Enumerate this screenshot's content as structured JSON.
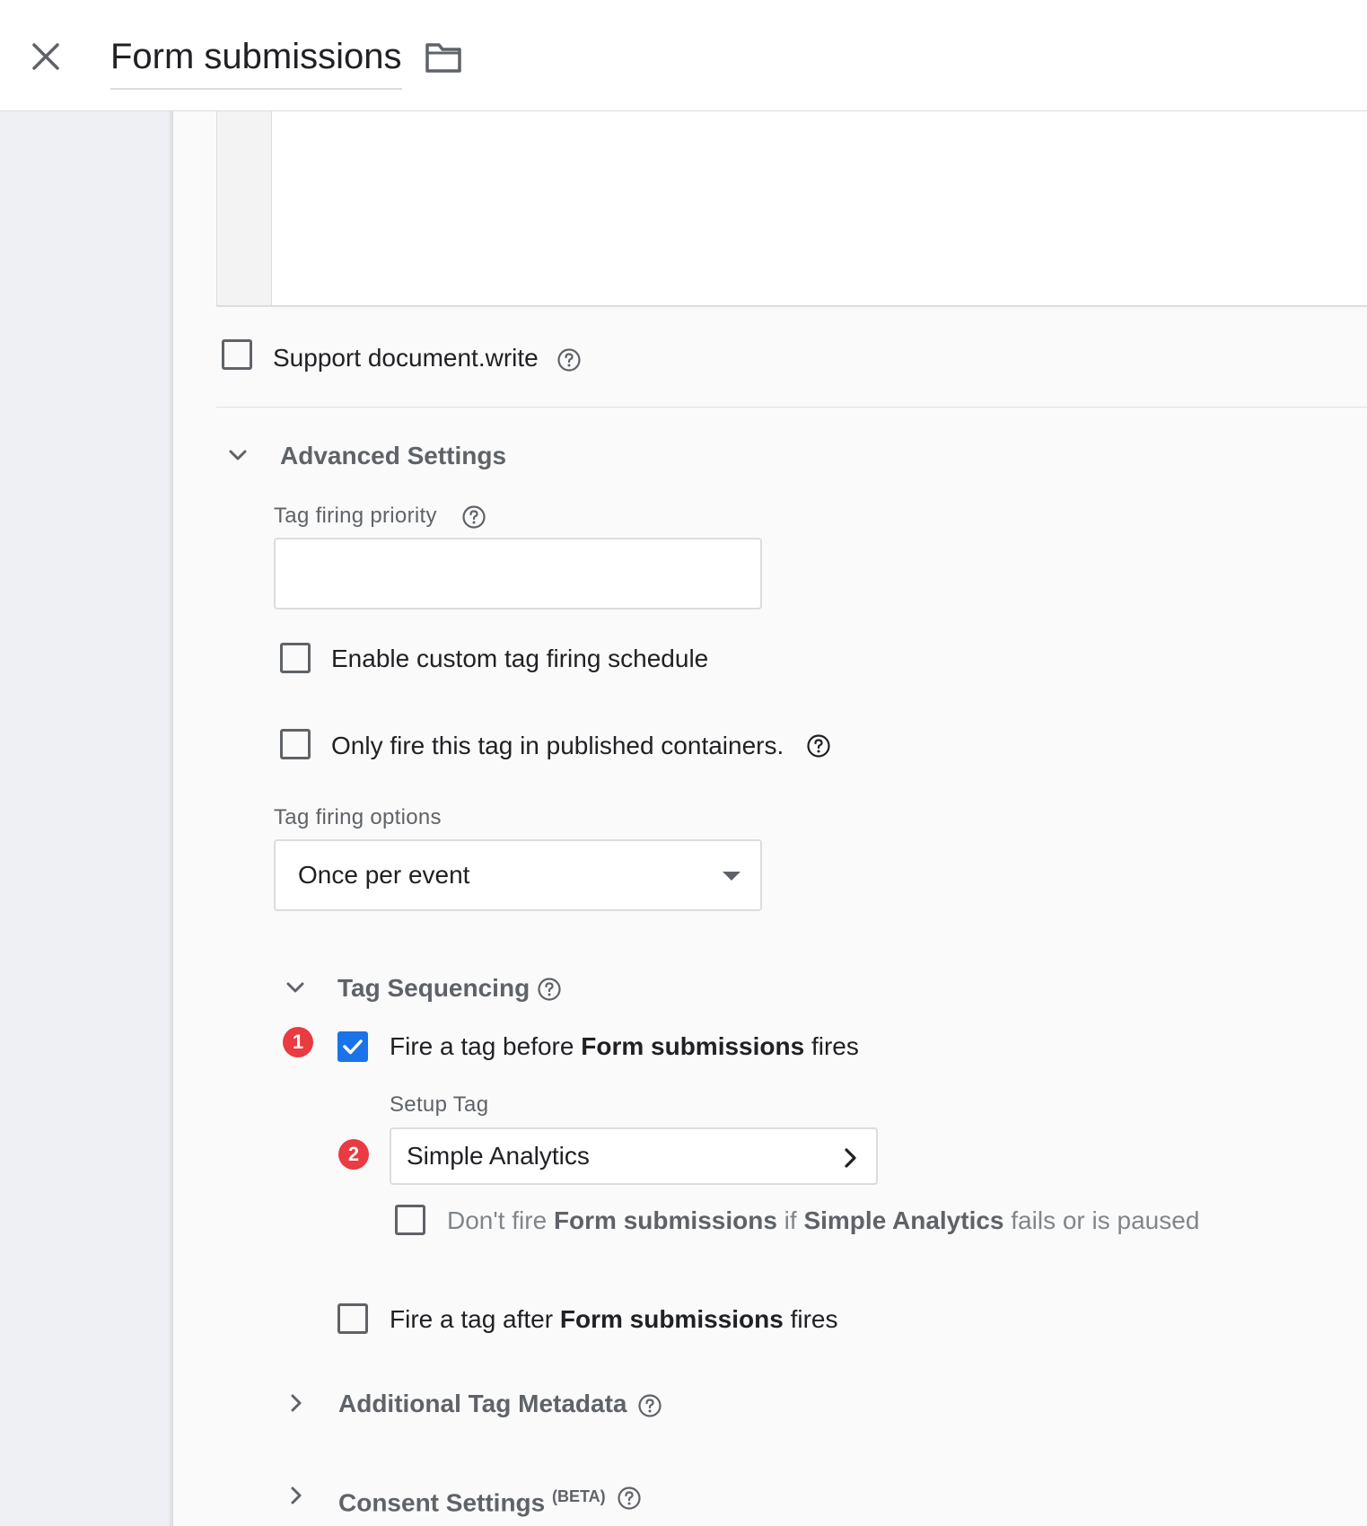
{
  "header": {
    "title": "Form submissions",
    "close_icon": "close-icon",
    "folder_icon": "folder-icon"
  },
  "custom_html": {
    "support_document_write_label": "Support document.write",
    "support_document_write_checked": false
  },
  "advanced_settings": {
    "title": "Advanced Settings",
    "expanded": true,
    "tag_firing_priority": {
      "label": "Tag firing priority",
      "value": ""
    },
    "enable_custom_schedule": {
      "label": "Enable custom tag firing schedule",
      "checked": false
    },
    "only_published": {
      "label": "Only fire this tag in published containers.",
      "checked": false
    },
    "tag_firing_options": {
      "label": "Tag firing options",
      "selected": "Once per event"
    },
    "tag_sequencing": {
      "title": "Tag Sequencing",
      "expanded": true,
      "fire_before": {
        "pre": "Fire a tag before",
        "tag": "Form submissions",
        "post": "fires",
        "checked": true,
        "badge": "1"
      },
      "setup_tag": {
        "label": "Setup Tag",
        "value": "Simple Analytics",
        "badge": "2"
      },
      "dont_fire": {
        "pre": "Don't fire",
        "tag": "Form submissions",
        "mid": "if",
        "setup": "Simple Analytics",
        "post": "fails or is paused",
        "checked": false
      },
      "fire_after": {
        "pre": "Fire a tag after",
        "tag": "Form submissions",
        "post": "fires",
        "checked": false
      }
    },
    "additional_tag_metadata": {
      "title": "Additional Tag Metadata",
      "expanded": false
    },
    "consent_settings": {
      "title": "Consent Settings",
      "beta": "(BETA)",
      "expanded": false
    }
  },
  "colors": {
    "accent": "#1a73e8",
    "badge": "#ea3a42",
    "text": "#202124",
    "muted": "#5f6368"
  }
}
